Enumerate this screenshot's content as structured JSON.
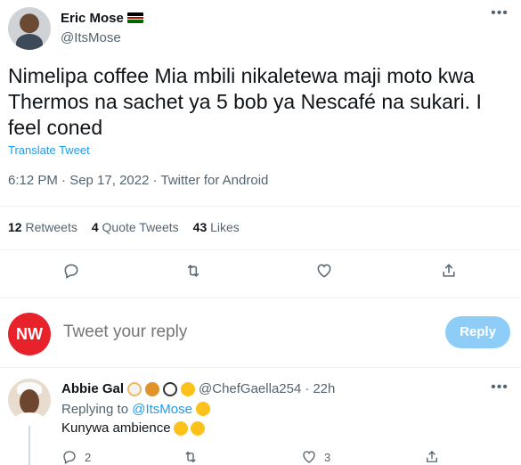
{
  "tweet": {
    "author_name": "Eric Mose",
    "author_handle": "@ItsMose",
    "flag_icon": "kenya-flag-icon",
    "text": "Nimelipa coffee Mia mbili nikaletewa maji moto kwa Thermos na sachet ya 5 bob ya Nescafé na sukari. I feel coned",
    "translate_label": "Translate Tweet",
    "meta": "6:12 PM · Sep 17, 2022 · Twitter for Android",
    "stats": [
      {
        "count": "12",
        "label": "Retweets"
      },
      {
        "count": "4",
        "label": "Quote Tweets"
      },
      {
        "count": "43",
        "label": "Likes"
      }
    ],
    "actions": [
      "reply-icon",
      "retweet-icon",
      "like-icon",
      "share-icon"
    ]
  },
  "composer": {
    "logo_text": "NW",
    "placeholder": "Tweet your reply",
    "button_label": "Reply"
  },
  "reply": {
    "name": "Abbie Gal",
    "handle": "@ChefGaella254",
    "separator": "·",
    "time": "22h",
    "replying_prefix": "Replying to",
    "replying_to": "@ItsMose",
    "text": "Kunywa ambience",
    "reply_count": "2",
    "like_count": "3",
    "emojis": [
      "chef-emoji",
      "croissant-emoji",
      "magnifier-emoji",
      "heart-eyes-emoji"
    ],
    "body_emojis": [
      "rofl-emoji",
      "rofl-emoji"
    ]
  },
  "colors": {
    "accent": "#1d9bf0",
    "reply_button": "#8ecdf8",
    "nw_brand": "#e8222b",
    "secondary_text": "#536471"
  }
}
